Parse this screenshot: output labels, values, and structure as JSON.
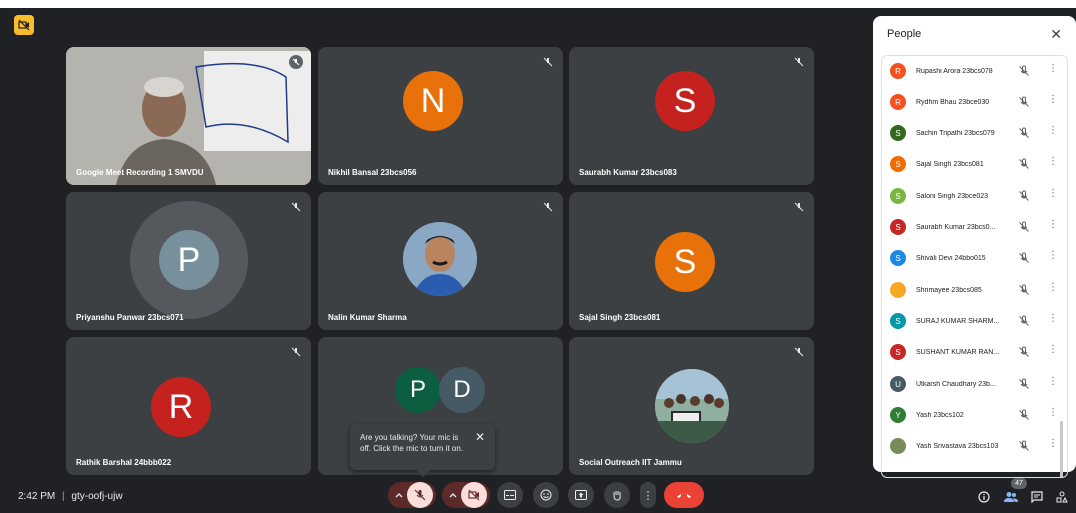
{
  "meeting": {
    "time": "2:42 PM",
    "separator": "|",
    "code": "gty-oofj-ujw"
  },
  "tiles": [
    {
      "name": "Google Meet Recording 1 SMVDU",
      "type": "video"
    },
    {
      "name": "Nikhil Bansal 23bcs056",
      "initial": "N",
      "color": "#e8710a"
    },
    {
      "name": "Saurabh Kumar 23bcs083",
      "initial": "S",
      "color": "#c5221f"
    },
    {
      "name": "Priyanshu Panwar 23bcs071",
      "initial": "P",
      "color": "#78909c"
    },
    {
      "name": "Nalin Kumar Sharma",
      "type": "photo"
    },
    {
      "name": "Sajal Singh 23bcs081",
      "initial": "S",
      "color": "#e8710a"
    },
    {
      "name": "Rathik Barshal 24bbb022",
      "initial": "R",
      "color": "#c5221f"
    },
    {
      "name": "",
      "initials": [
        "P",
        "D"
      ],
      "colors": [
        "#0b5e3f",
        "#455a64"
      ]
    },
    {
      "name": "Social Outreach IIT Jammu",
      "type": "photo"
    }
  ],
  "tooltip": {
    "text": "Are you talking? Your mic is off. Click the mic to turn it on.",
    "close": "✕"
  },
  "people": {
    "title": "People",
    "close": "✕",
    "count": "47",
    "list": [
      {
        "name": "Rupashi Arora 23bcs078",
        "initial": "R",
        "color": "#f4511e"
      },
      {
        "name": "Rydhm Bhau 23bce030",
        "initial": "R",
        "color": "#f4511e"
      },
      {
        "name": "Sachin Tripathi 23bcs079",
        "initial": "S",
        "color": "#33691e"
      },
      {
        "name": "Sajal Singh 23bcs081",
        "initial": "S",
        "color": "#ef6c00"
      },
      {
        "name": "Saloni Singh 23bce023",
        "initial": "S",
        "color": "#7cb342"
      },
      {
        "name": "Saurabh Kumar 23bcs0...",
        "initial": "S",
        "color": "#c62828"
      },
      {
        "name": "Shivali Devi 24bbo015",
        "initial": "S",
        "color": "#1e88e5"
      },
      {
        "name": "Shrimayee 23bcs085",
        "initial": "",
        "color": "#f9a825"
      },
      {
        "name": "SURAJ KUMAR SHARM...",
        "initial": "S",
        "color": "#0097a7"
      },
      {
        "name": "SUSHANT KUMAR RAN...",
        "initial": "S",
        "color": "#c62828"
      },
      {
        "name": "Utkarsh Chaudhary 23b...",
        "initial": "U",
        "color": "#455a64"
      },
      {
        "name": "Yash 23bcs102",
        "initial": "Y",
        "color": "#2e7d32"
      },
      {
        "name": "Yash Srivastava 23bcs103",
        "initial": "",
        "color": "#7a8b5a"
      }
    ]
  },
  "controls": {
    "more": "⋮"
  },
  "colors": {
    "background": "#202124",
    "tile": "#3c4043",
    "mic_off": "#f9dedc",
    "end_call": "#ea4335",
    "accent_blue": "#8ab4f8"
  }
}
